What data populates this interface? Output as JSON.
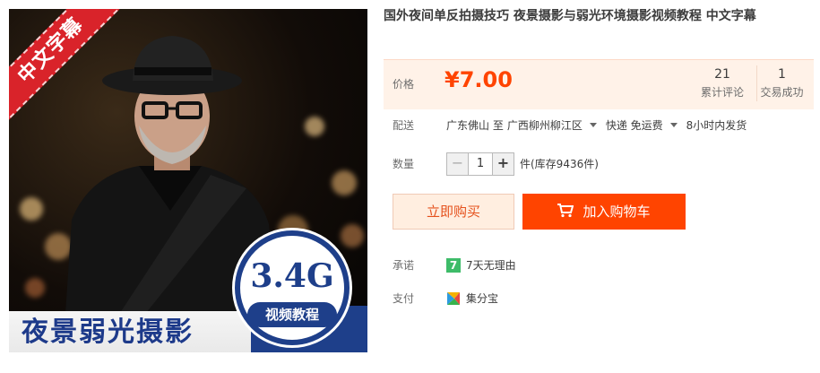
{
  "image": {
    "ribbon_text": "中文字幕",
    "headline": "夜景弱光摄影",
    "badge_size": "3.4G",
    "badge_text": "视频教程"
  },
  "product": {
    "title": "国外夜间单反拍摄技巧 夜景摄影与弱光环境摄影视频教程 中文字幕"
  },
  "price": {
    "label": "价格",
    "value": "¥7.00",
    "reviews_count": "21",
    "reviews_label": "累计评论",
    "trades_count": "1",
    "trades_label": "交易成功"
  },
  "shipping": {
    "label": "配送",
    "from": "广东佛山 至",
    "to": "广西柳州柳江区",
    "method": "快递 免运费",
    "dispatch": "8小时内发货"
  },
  "quantity": {
    "label": "数量",
    "minus": "−",
    "value": "1",
    "plus": "+",
    "stock": "件(库存9436件)"
  },
  "actions": {
    "buy_now": "立即购买",
    "add_to_cart": "加入购物车"
  },
  "promise": {
    "label": "承诺",
    "icon_text": "7",
    "text": "7天无理由"
  },
  "payment": {
    "label": "支付",
    "text": "集分宝"
  },
  "colors": {
    "accent": "#ff4400",
    "price_panel": "#fff2e8",
    "ribbon": "#d9232a",
    "badge_blue": "#1e3f8a"
  }
}
